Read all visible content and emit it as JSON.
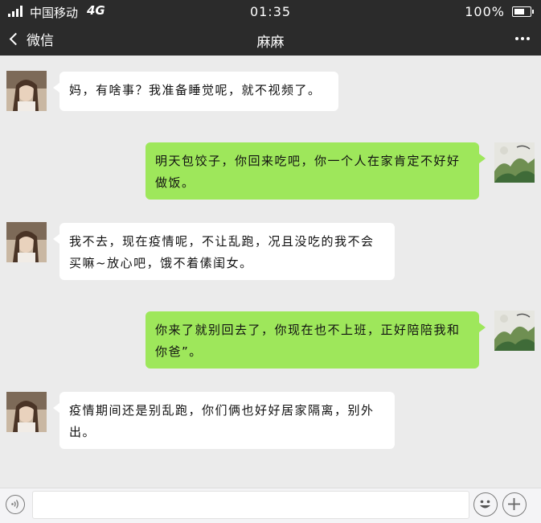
{
  "status_bar": {
    "carrier": "中国移动",
    "network": "4G",
    "time": "01:35",
    "battery": "100%"
  },
  "title_bar": {
    "back_label": "微信",
    "title": "麻麻"
  },
  "messages": [
    {
      "sender": "麻麻",
      "side": "left",
      "text": "妈，有啥事？我准备睡觉呢，就不视频了。"
    },
    {
      "sender": "me",
      "side": "right",
      "text": "明天包饺子，你回来吃吧，你一个人在家肯定不好好做饭。"
    },
    {
      "sender": "麻麻",
      "side": "left",
      "text": "我不去，现在疫情呢，不让乱跑，况且没吃的我不会买嘛~放心吧，饿不着傃闺女。"
    },
    {
      "sender": "me",
      "side": "right",
      "text": "你来了就别回去了，你现在也不上班，正好陪陪我和你爸”。"
    },
    {
      "sender": "麻麻",
      "side": "left",
      "text": "疫情期间还是别乱跑，你们俩也好好居家隔离，别外出。"
    }
  ],
  "input_bar": {
    "input_value": "",
    "icons": [
      "voice-icon",
      "emoji-icon",
      "plus-icon"
    ]
  },
  "colors": {
    "header_bg": "#2b2b2b",
    "chat_bg": "#ebebeb",
    "incoming_bubble": "#ffffff",
    "outgoing_bubble": "#9ee75b"
  }
}
